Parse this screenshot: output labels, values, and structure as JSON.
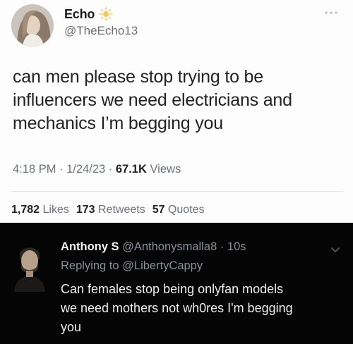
{
  "tweet": {
    "author": {
      "display_name": "Echo",
      "handle": "@TheEcho13",
      "name_badge_icon": "sun-icon"
    },
    "text_lines": [
      "can men please stop trying to be",
      "influencers we need electricians and",
      "mechanics I’m begging you"
    ],
    "meta": {
      "time": "4:18 PM",
      "sep1": " · ",
      "date": "1/24/23",
      "sep2": " · ",
      "views_count": "67.1K",
      "views_label": " Views"
    },
    "stats": {
      "likes_count": "1,782",
      "likes_label": " Likes",
      "retweets_count": "173",
      "retweets_label": " Retweets",
      "quotes_count": "57",
      "quotes_label": " Quotes"
    },
    "more_icon": "more-horizontal-icon"
  },
  "reply": {
    "display_name": "Anthony S",
    "handle": "@Anthonysmalla8",
    "sep": " · ",
    "time_ago": "10s",
    "replying_prefix": "Replying to ",
    "replying_to": "@LibertyCappy",
    "text_lines": [
      "Can females stop being onlyfan models",
      "we need mothers not wh0res I'm begging",
      "you"
    ],
    "chevron_icon": "chevron-down-icon"
  },
  "colors": {
    "reply_background": "#050505",
    "muted_text": "#6b7278",
    "badge_sun": "#f2c46a"
  }
}
